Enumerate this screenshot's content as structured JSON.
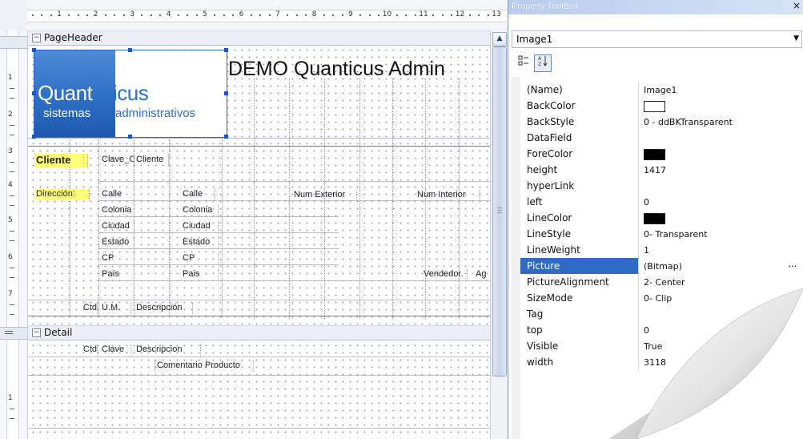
{
  "ruler": {
    "h_numbers": [
      "1",
      "2",
      "3",
      "4",
      "5",
      "6",
      "7",
      "8",
      "9",
      "10",
      "11",
      "12",
      "13"
    ],
    "v_numbers": [
      "1",
      "2",
      "3",
      "4",
      "5",
      "6",
      "7",
      "1",
      "2"
    ]
  },
  "sections": {
    "page_header": "PageHeader",
    "detail": "Detail"
  },
  "header": {
    "title": "DEMO Quanticus Admin",
    "logo": {
      "word_a": "Quant",
      "word_b": "icus",
      "sub_a": "sistemas",
      "sub_b": "administrativos"
    },
    "fields": {
      "cliente": "Cliente",
      "clave_cli": "Clave_Cli",
      "cliente2": "Cliente",
      "direccion": "Dirección:",
      "calle": "Calle",
      "calle2": "Calle",
      "num_ext": "Num Exterior",
      "num_int": "Num Interior",
      "colonia": "Colonia",
      "colonia2": "Colonia",
      "ciudad": "Ciudad",
      "ciudad2": "Ciudad",
      "estado": "Estado",
      "estado2": "Estado",
      "cp": "CP",
      "cp2": "CP",
      "pais": "País",
      "pais2": "Pais",
      "vendedor": "Vendedor.",
      "ag": "Ag",
      "ctd": "Ctd",
      "um": "U.M.",
      "descripcion": "Descripción"
    }
  },
  "detail": {
    "ctd": "Ctd",
    "clave": "Clave",
    "descripcion": "Descripcion",
    "comentario": "Comentario Producto"
  },
  "toolbox": {
    "title": "Property ToolBox",
    "close": "×",
    "selected_object": "Image1",
    "properties": [
      {
        "name": "(Name)",
        "value": "Image1"
      },
      {
        "name": "BackColor",
        "value": "",
        "swatch": "#ffffff"
      },
      {
        "name": "BackStyle",
        "value": "0 - ddBKTransparent"
      },
      {
        "name": "DataField",
        "value": ""
      },
      {
        "name": "ForeColor",
        "value": "",
        "swatch": "#000000"
      },
      {
        "name": "height",
        "value": "1417"
      },
      {
        "name": "hyperLink",
        "value": ""
      },
      {
        "name": "left",
        "value": "0"
      },
      {
        "name": "LineColor",
        "value": "",
        "swatch": "#000000"
      },
      {
        "name": "LineStyle",
        "value": "0- Transparent"
      },
      {
        "name": "LineWeight",
        "value": "1"
      },
      {
        "name": "Picture",
        "value": "(Bitmap)",
        "selected": true
      },
      {
        "name": "PictureAlignment",
        "value": "2- Center"
      },
      {
        "name": "SizeMode",
        "value": "0- Clip"
      },
      {
        "name": "Tag",
        "value": ""
      },
      {
        "name": "top",
        "value": "0"
      },
      {
        "name": "Visible",
        "value": "True"
      },
      {
        "name": "width",
        "value": "3118"
      }
    ],
    "ellipsis": "..."
  },
  "colors": {
    "selection": "#316ac5",
    "highlight": "#ffff7a",
    "logo_blue": "#2d6fc6"
  }
}
